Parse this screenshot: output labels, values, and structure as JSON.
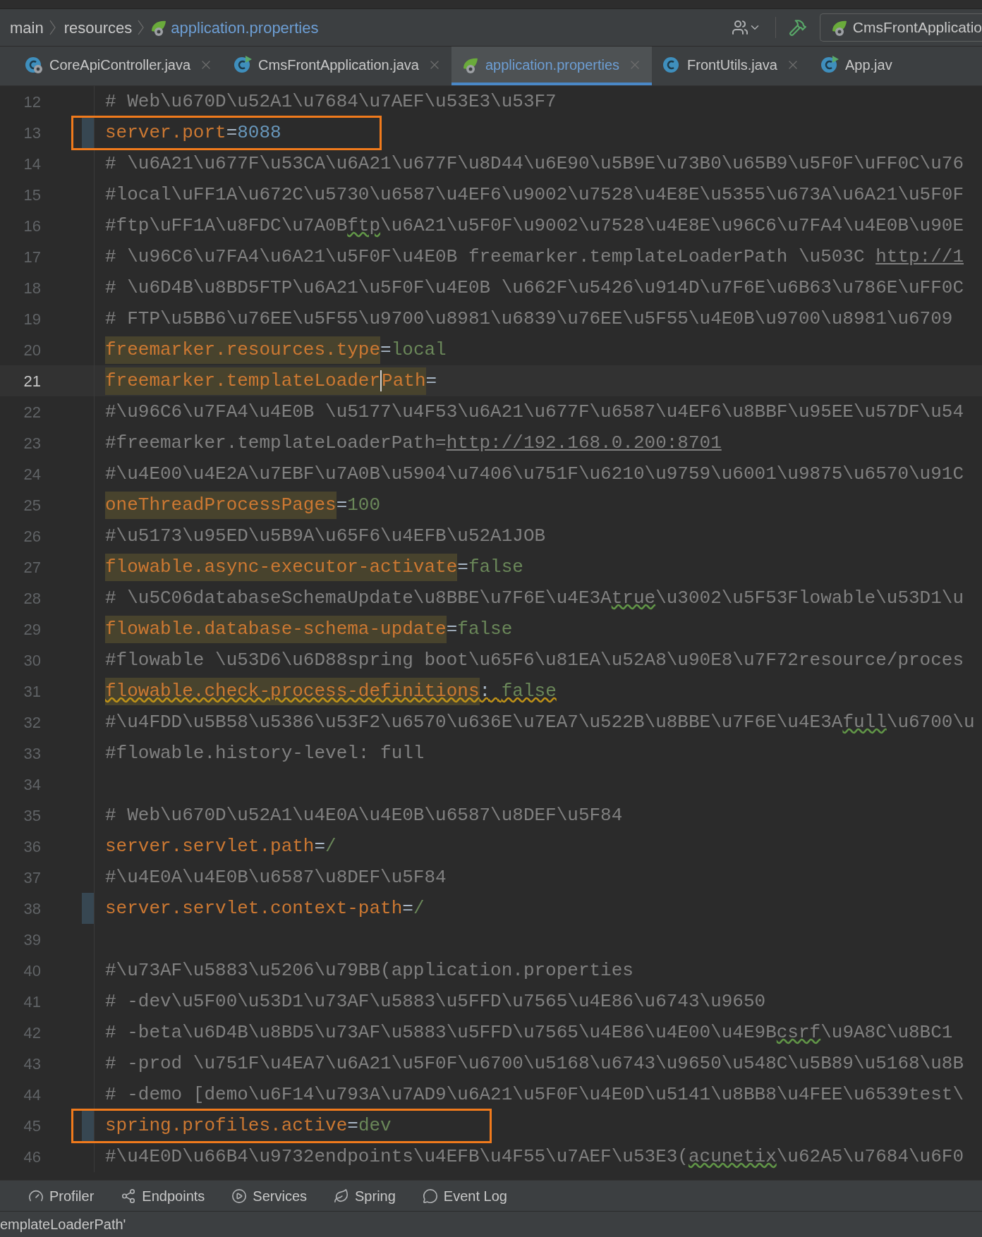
{
  "breadcrumb": [
    {
      "text": "main",
      "kind": "folder"
    },
    {
      "text": "resources",
      "kind": "folder"
    },
    {
      "text": "application.properties",
      "kind": "file"
    }
  ],
  "toolbar": {
    "run_config": "CmsFrontApplicatio"
  },
  "tabs": [
    {
      "label": "CoreApiController.java",
      "kind": "service",
      "selected": false,
      "closable": true
    },
    {
      "label": "CmsFrontApplication.java",
      "kind": "runnable",
      "selected": false,
      "closable": true
    },
    {
      "label": "application.properties",
      "kind": "spring",
      "selected": true,
      "closable": true
    },
    {
      "label": "FrontUtils.java",
      "kind": "class",
      "selected": false,
      "closable": true
    },
    {
      "label": "App.jav",
      "kind": "runnable",
      "selected": false,
      "closable": false
    }
  ],
  "lines": [
    {
      "number": "12",
      "kind": "comment",
      "changed": false,
      "current": false,
      "boxed": false,
      "parts": [
        {
          "text": "# Web\\u670D\\u52A1\\u7684\\u7AEF\\u53E3\\u53F7",
          "kind": "plain"
        }
      ]
    },
    {
      "number": "13",
      "kind": "numeric",
      "changed": true,
      "current": false,
      "boxed": true,
      "key": "server.port",
      "separator": "=",
      "value": "8088",
      "highlighted": false,
      "warning": false
    },
    {
      "number": "14",
      "kind": "comment",
      "changed": false,
      "current": false,
      "boxed": false,
      "parts": [
        {
          "text": "# \\u6A21\\u677F\\u53CA\\u6A21\\u677F\\u8D44\\u6E90\\u5B9E\\u73B0\\u65B9\\u5F0F\\uFF0C\\u76",
          "kind": "plain"
        }
      ]
    },
    {
      "number": "15",
      "kind": "comment",
      "changed": false,
      "current": false,
      "boxed": false,
      "parts": [
        {
          "text": "#local\\uFF1A\\u672C\\u5730\\u6587\\u4EF6\\u9002\\u7528\\u4E8E\\u5355\\u673A\\u6A21\\u5F0F",
          "kind": "plain"
        }
      ]
    },
    {
      "number": "16",
      "kind": "comment",
      "changed": false,
      "current": false,
      "boxed": false,
      "parts": [
        {
          "text": "#ftp\\uFF1A\\u8FDC\\u7A0B",
          "kind": "plain"
        },
        {
          "text": "ftp",
          "kind": "typo"
        },
        {
          "text": "\\u6A21\\u5F0F\\u9002\\u7528\\u4E8E\\u96C6\\u7FA4\\u4E0B\\u90E",
          "kind": "plain"
        }
      ]
    },
    {
      "number": "17",
      "kind": "comment",
      "changed": false,
      "current": false,
      "boxed": false,
      "parts": [
        {
          "text": "# \\u96C6\\u7FA4\\u6A21\\u5F0F\\u4E0B freemarker.templateLoaderPath \\u503C ",
          "kind": "plain"
        },
        {
          "text": "http://1",
          "kind": "link"
        }
      ]
    },
    {
      "number": "18",
      "kind": "comment",
      "changed": false,
      "current": false,
      "boxed": false,
      "parts": [
        {
          "text": "# \\u6D4B\\u8BD5FTP\\u6A21\\u5F0F\\u4E0B \\u662F\\u5426\\u914D\\u7F6E\\u6B63\\u786E\\uFF0C",
          "kind": "plain"
        }
      ]
    },
    {
      "number": "19",
      "kind": "comment",
      "changed": false,
      "current": false,
      "boxed": false,
      "parts": [
        {
          "text": "# FTP\\u5BB6\\u76EE\\u5F55\\u9700\\u8981\\u6839\\u76EE\\u5F55\\u4E0B\\u9700\\u8981\\u6709",
          "kind": "plain"
        }
      ]
    },
    {
      "number": "20",
      "kind": "property",
      "changed": false,
      "current": false,
      "boxed": false,
      "key": "freemarker.resources.type",
      "separator": "=",
      "value": "local",
      "highlighted": true,
      "warning": false
    },
    {
      "number": "21",
      "kind": "property",
      "changed": false,
      "current": true,
      "boxed": false,
      "key": "freemarker.templateLoader",
      "key_tail": "Path",
      "separator": "=",
      "highlighted": true,
      "warning": false
    },
    {
      "number": "22",
      "kind": "comment",
      "changed": false,
      "current": false,
      "boxed": false,
      "parts": [
        {
          "text": "#\\u96C6\\u7FA4\\u4E0B \\u5177\\u4F53\\u6A21\\u677F\\u6587\\u4EF6\\u8BBF\\u95EE\\u57DF\\u54",
          "kind": "plain"
        }
      ]
    },
    {
      "number": "23",
      "kind": "comment",
      "changed": false,
      "current": false,
      "boxed": false,
      "parts": [
        {
          "text": "#freemarker.templateLoaderPath=",
          "kind": "plain"
        },
        {
          "text": "http://192.168.0.200:8701",
          "kind": "link"
        }
      ]
    },
    {
      "number": "24",
      "kind": "comment",
      "changed": false,
      "current": false,
      "boxed": false,
      "parts": [
        {
          "text": "#\\u4E00\\u4E2A\\u7EBF\\u7A0B\\u5904\\u7406\\u751F\\u6210\\u9759\\u6001\\u9875\\u6570\\u91C",
          "kind": "plain"
        }
      ]
    },
    {
      "number": "25",
      "kind": "property",
      "changed": false,
      "current": false,
      "boxed": false,
      "key": "oneThreadProcessPages",
      "separator": "=",
      "value": "100",
      "highlighted": true,
      "warning": false
    },
    {
      "number": "26",
      "kind": "comment",
      "changed": false,
      "current": false,
      "boxed": false,
      "parts": [
        {
          "text": "#\\u5173\\u95ED\\u5B9A\\u65F6\\u4EFB\\u52A1JOB",
          "kind": "plain"
        }
      ]
    },
    {
      "number": "27",
      "kind": "property",
      "changed": false,
      "current": false,
      "boxed": false,
      "key": "flowable.async-executor-activate",
      "separator": "=",
      "value": "false",
      "highlighted": true,
      "warning": false
    },
    {
      "number": "28",
      "kind": "comment",
      "changed": false,
      "current": false,
      "boxed": false,
      "parts": [
        {
          "text": "# \\u5C06databaseSchemaUpdate\\u8BBE\\u7F6E\\u4E3A",
          "kind": "plain"
        },
        {
          "text": "true",
          "kind": "typo"
        },
        {
          "text": "\\u3002\\u5F53Flowable\\u53D1\\u",
          "kind": "plain"
        }
      ]
    },
    {
      "number": "29",
      "kind": "property",
      "changed": false,
      "current": false,
      "boxed": false,
      "key": "flowable.database-schema-update",
      "separator": "=",
      "value": "false",
      "highlighted": true,
      "warning": false
    },
    {
      "number": "30",
      "kind": "comment",
      "changed": false,
      "current": false,
      "boxed": false,
      "parts": [
        {
          "text": "#flowable \\u53D6\\u6D88spring boot\\u65F6\\u81EA\\u52A8\\u90E8\\u7F72resource/proces",
          "kind": "plain"
        }
      ]
    },
    {
      "number": "31",
      "kind": "property",
      "changed": false,
      "current": false,
      "boxed": false,
      "key": "flowable.check-process-definitions",
      "separator": ": ",
      "value": "false",
      "highlighted": true,
      "warning": true
    },
    {
      "number": "32",
      "kind": "comment",
      "changed": false,
      "current": false,
      "boxed": false,
      "parts": [
        {
          "text": "#\\u4FDD\\u5B58\\u5386\\u53F2\\u6570\\u636E\\u7EA7\\u522B\\u8BBE\\u7F6E\\u4E3A",
          "kind": "plain"
        },
        {
          "text": "full",
          "kind": "typo"
        },
        {
          "text": "\\u6700\\u",
          "kind": "plain"
        }
      ]
    },
    {
      "number": "33",
      "kind": "comment",
      "changed": false,
      "current": false,
      "boxed": false,
      "parts": [
        {
          "text": "#flowable.history-level: full",
          "kind": "plain"
        }
      ]
    },
    {
      "number": "34",
      "kind": "blank",
      "changed": false,
      "current": false,
      "boxed": false
    },
    {
      "number": "35",
      "kind": "comment",
      "changed": false,
      "current": false,
      "boxed": false,
      "parts": [
        {
          "text": "# Web\\u670D\\u52A1\\u4E0A\\u4E0B\\u6587\\u8DEF\\u5F84",
          "kind": "plain"
        }
      ]
    },
    {
      "number": "36",
      "kind": "property",
      "changed": false,
      "current": false,
      "boxed": false,
      "key": "server.servlet.path",
      "separator": "=",
      "value": "/",
      "highlighted": false,
      "warning": false
    },
    {
      "number": "37",
      "kind": "comment",
      "changed": false,
      "current": false,
      "boxed": false,
      "parts": [
        {
          "text": "#\\u4E0A\\u4E0B\\u6587\\u8DEF\\u5F84",
          "kind": "plain"
        }
      ]
    },
    {
      "number": "38",
      "kind": "property",
      "changed": true,
      "current": false,
      "boxed": false,
      "key": "server.servlet.context-path",
      "separator": "=",
      "value": "/",
      "highlighted": false,
      "warning": false
    },
    {
      "number": "39",
      "kind": "blank",
      "changed": false,
      "current": false,
      "boxed": false
    },
    {
      "number": "40",
      "kind": "comment",
      "changed": false,
      "current": false,
      "boxed": false,
      "parts": [
        {
          "text": "#\\u73AF\\u5883\\u5206\\u79BB(application.properties",
          "kind": "plain"
        }
      ]
    },
    {
      "number": "41",
      "kind": "comment",
      "changed": false,
      "current": false,
      "boxed": false,
      "parts": [
        {
          "text": "# -dev\\u5F00\\u53D1\\u73AF\\u5883\\u5FFD\\u7565\\u4E86\\u6743\\u9650",
          "kind": "plain"
        }
      ]
    },
    {
      "number": "42",
      "kind": "comment",
      "changed": false,
      "current": false,
      "boxed": false,
      "parts": [
        {
          "text": "# -beta\\u6D4B\\u8BD5\\u73AF\\u5883\\u5FFD\\u7565\\u4E86\\u4E00\\u4E9B",
          "kind": "plain"
        },
        {
          "text": "csrf",
          "kind": "typo"
        },
        {
          "text": "\\u9A8C\\u8BC1",
          "kind": "plain"
        }
      ]
    },
    {
      "number": "43",
      "kind": "comment",
      "changed": false,
      "current": false,
      "boxed": false,
      "parts": [
        {
          "text": "# -prod \\u751F\\u4EA7\\u6A21\\u5F0F\\u6700\\u5168\\u6743\\u9650\\u548C\\u5B89\\u5168\\u8B",
          "kind": "plain"
        }
      ]
    },
    {
      "number": "44",
      "kind": "comment",
      "changed": false,
      "current": false,
      "boxed": false,
      "parts": [
        {
          "text": "# -demo [demo\\u6F14\\u793A\\u7AD9\\u6A21\\u5F0F\\u4E0D\\u5141\\u8BB8\\u4FEE\\u6539test\\",
          "kind": "plain"
        }
      ]
    },
    {
      "number": "45",
      "kind": "property",
      "changed": true,
      "current": false,
      "boxed": true,
      "key": "spring.profiles.active",
      "separator": "=",
      "value": "dev",
      "highlighted": false,
      "warning": false
    },
    {
      "number": "46",
      "kind": "comment",
      "changed": false,
      "current": false,
      "boxed": false,
      "parts": [
        {
          "text": "#\\u4E0D\\u66B4\\u9732endpoints\\u4EFB\\u4F55\\u7AEF\\u53E3(",
          "kind": "plain"
        },
        {
          "text": "acunetix",
          "kind": "typo"
        },
        {
          "text": "\\u62A5\\u7684\\u6F0",
          "kind": "plain"
        }
      ]
    }
  ],
  "tool_windows": [
    {
      "label": "Profiler",
      "kind": "profiler"
    },
    {
      "label": "Endpoints",
      "kind": "endpoints"
    },
    {
      "label": "Services",
      "kind": "services"
    },
    {
      "label": "Spring",
      "kind": "spring"
    },
    {
      "label": "Event Log",
      "kind": "log"
    }
  ],
  "status_bar": {
    "message": "emplateLoaderPath'"
  }
}
